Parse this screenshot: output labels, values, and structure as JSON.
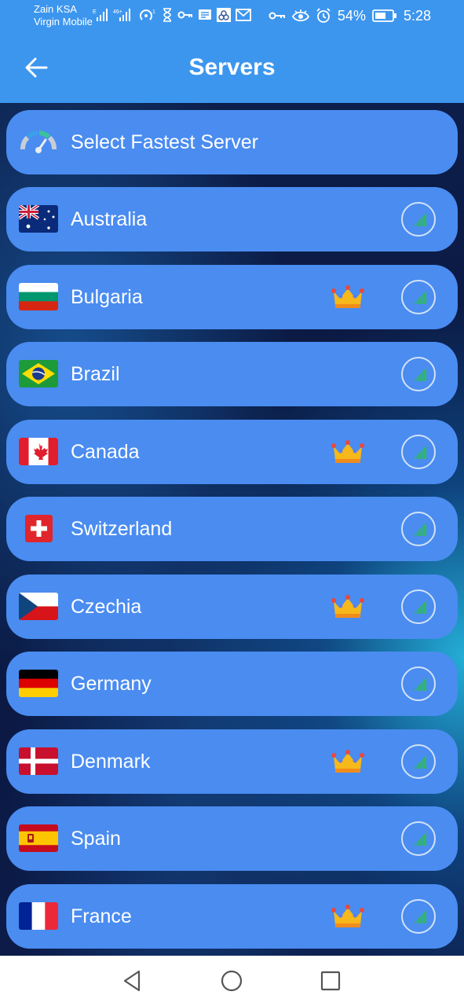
{
  "status_bar": {
    "carrier_1": "Zain KSA",
    "carrier_2": "Virgin Mobile",
    "battery_percent": "54%",
    "time": "5:28"
  },
  "header": {
    "title": "Servers",
    "background_color": "#3d96ee"
  },
  "fastest_server": {
    "label": "Select Fastest Server",
    "icon": "speedometer-icon"
  },
  "servers": [
    {
      "country": "Australia",
      "flag": "australia-flag",
      "premium": false
    },
    {
      "country": "Bulgaria",
      "flag": "bulgaria-flag",
      "premium": true
    },
    {
      "country": "Brazil",
      "flag": "brazil-flag",
      "premium": false
    },
    {
      "country": "Canada",
      "flag": "canada-flag",
      "premium": true
    },
    {
      "country": "Switzerland",
      "flag": "switzerland-flag",
      "premium": false
    },
    {
      "country": "Czechia",
      "flag": "czechia-flag",
      "premium": true
    },
    {
      "country": "Germany",
      "flag": "germany-flag",
      "premium": false
    },
    {
      "country": "Denmark",
      "flag": "denmark-flag",
      "premium": true
    },
    {
      "country": "Spain",
      "flag": "spain-flag",
      "premium": false
    },
    {
      "country": "France",
      "flag": "france-flag",
      "premium": true
    }
  ],
  "colors": {
    "row_background": "#4a8cf0",
    "signal_green": "#2fb866",
    "crown_gold": "#f6b81a"
  }
}
